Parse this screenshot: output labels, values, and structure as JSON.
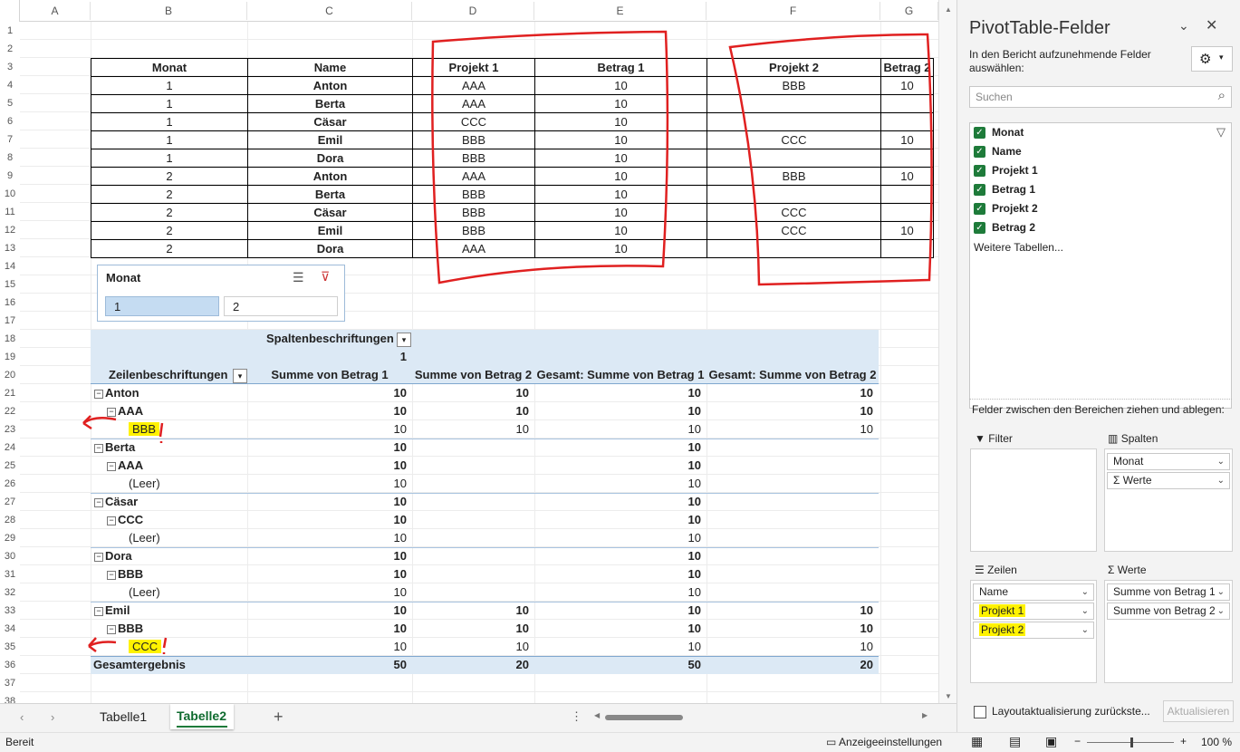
{
  "columns": [
    "A",
    "B",
    "C",
    "D",
    "E",
    "F",
    "G"
  ],
  "rows": [
    "1",
    "2",
    "3",
    "4",
    "5",
    "6",
    "7",
    "8",
    "9",
    "10",
    "11",
    "12",
    "13",
    "14",
    "15",
    "16",
    "17",
    "18",
    "19",
    "20",
    "21",
    "22",
    "23",
    "24",
    "25",
    "26",
    "27",
    "28",
    "29",
    "30",
    "31",
    "32",
    "33",
    "34",
    "35",
    "36",
    "37",
    "38"
  ],
  "table": {
    "headers": [
      "Monat",
      "Name",
      "Projekt 1",
      "Betrag 1",
      "Projekt 2",
      "Betrag 2"
    ],
    "rows": [
      [
        "1",
        "Anton",
        "AAA",
        "10",
        "BBB",
        "10"
      ],
      [
        "1",
        "Berta",
        "AAA",
        "10",
        "",
        ""
      ],
      [
        "1",
        "Cäsar",
        "CCC",
        "10",
        "",
        ""
      ],
      [
        "1",
        "Emil",
        "BBB",
        "10",
        "CCC",
        "10"
      ],
      [
        "1",
        "Dora",
        "BBB",
        "10",
        "",
        ""
      ],
      [
        "2",
        "Anton",
        "AAA",
        "10",
        "BBB",
        "10"
      ],
      [
        "2",
        "Berta",
        "BBB",
        "10",
        "",
        ""
      ],
      [
        "2",
        "Cäsar",
        "BBB",
        "10",
        "CCC",
        ""
      ],
      [
        "2",
        "Emil",
        "BBB",
        "10",
        "CCC",
        "10"
      ],
      [
        "2",
        "Dora",
        "AAA",
        "10",
        "",
        ""
      ]
    ]
  },
  "slicer": {
    "title": "Monat",
    "items": [
      "1",
      "2"
    ],
    "selected_index": 0
  },
  "pivot": {
    "col_labels_header": "Spaltenbeschriftungen",
    "col_value": "1",
    "row_labels_header": "Zeilenbeschriftungen",
    "value_headers": [
      "Summe von Betrag 1",
      "Summe von Betrag 2",
      "Gesamt: Summe von Betrag 1",
      "Gesamt: Summe von Betrag 2"
    ],
    "rows": [
      {
        "label": "Anton",
        "level": 0,
        "values": [
          "10",
          "10",
          "10",
          "10"
        ]
      },
      {
        "label": "AAA",
        "level": 1,
        "values": [
          "10",
          "10",
          "10",
          "10"
        ]
      },
      {
        "label": "BBB",
        "level": 2,
        "values": [
          "10",
          "10",
          "10",
          "10"
        ],
        "highlight": true
      },
      {
        "label": "Berta",
        "level": 0,
        "values": [
          "10",
          "",
          "10",
          ""
        ]
      },
      {
        "label": "AAA",
        "level": 1,
        "values": [
          "10",
          "",
          "10",
          ""
        ]
      },
      {
        "label": "(Leer)",
        "level": 2,
        "values": [
          "10",
          "",
          "10",
          ""
        ]
      },
      {
        "label": "Cäsar",
        "level": 0,
        "values": [
          "10",
          "",
          "10",
          ""
        ]
      },
      {
        "label": "CCC",
        "level": 1,
        "values": [
          "10",
          "",
          "10",
          ""
        ]
      },
      {
        "label": "(Leer)",
        "level": 2,
        "values": [
          "10",
          "",
          "10",
          ""
        ]
      },
      {
        "label": "Dora",
        "level": 0,
        "values": [
          "10",
          "",
          "10",
          ""
        ]
      },
      {
        "label": "BBB",
        "level": 1,
        "values": [
          "10",
          "",
          "10",
          ""
        ]
      },
      {
        "label": "(Leer)",
        "level": 2,
        "values": [
          "10",
          "",
          "10",
          ""
        ]
      },
      {
        "label": "Emil",
        "level": 0,
        "values": [
          "10",
          "10",
          "10",
          "10"
        ]
      },
      {
        "label": "BBB",
        "level": 1,
        "values": [
          "10",
          "10",
          "10",
          "10"
        ]
      },
      {
        "label": "CCC",
        "level": 2,
        "values": [
          "10",
          "10",
          "10",
          "10"
        ],
        "highlight": true
      }
    ],
    "total": {
      "label": "Gesamtergebnis",
      "values": [
        "50",
        "20",
        "50",
        "20"
      ]
    }
  },
  "sheet_tabs": [
    "Tabelle1",
    "Tabelle2"
  ],
  "active_tab": "Tabelle2",
  "status": {
    "left": "Bereit",
    "display_settings": "Anzeigeeinstellungen",
    "zoom": "100 %"
  },
  "pane": {
    "title": "PivotTable-Felder",
    "subtitle": "In den Bericht aufzunehmende Felder auswählen:",
    "search_placeholder": "Suchen",
    "fields": [
      "Monat",
      "Name",
      "Projekt 1",
      "Betrag 1",
      "Projekt 2",
      "Betrag 2"
    ],
    "more_tables": "Weitere Tabellen...",
    "drag_text": "Felder zwischen den Bereichen ziehen und ablegen:",
    "area_filter": "Filter",
    "area_columns": "Spalten",
    "area_rows": "Zeilen",
    "area_values": "Werte",
    "columns_items": [
      "Monat",
      "Werte"
    ],
    "rows_items": [
      "Name",
      "Projekt 1",
      "Projekt 2"
    ],
    "values_items": [
      "Summe von Betrag 1",
      "Summe von Betrag 2"
    ],
    "defer_label": "Layoutaktualisierung zurückste...",
    "update_button": "Aktualisieren"
  },
  "colors": {
    "accent_green": "#1e7b3a",
    "pivot_header": "#dce9f5",
    "annotation_red": "#e02020",
    "highlight": "#fff200"
  }
}
